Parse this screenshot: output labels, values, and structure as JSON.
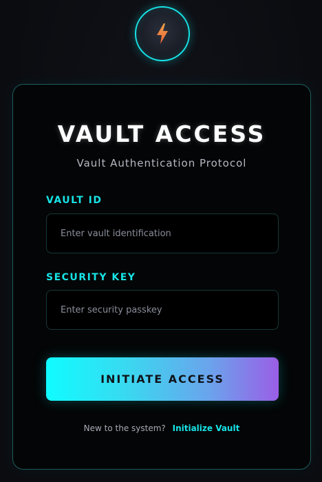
{
  "logo": {
    "icon": "lightning-bolt-icon",
    "accent": "#17e3e6",
    "bolt_color": "#f08a3c"
  },
  "card": {
    "title": "VAULT ACCESS",
    "subtitle": "Vault Authentication Protocol",
    "vault_id": {
      "label": "VAULT ID",
      "placeholder": "Enter vault identification",
      "value": ""
    },
    "security_key": {
      "label": "SECURITY KEY",
      "placeholder": "Enter security passkey",
      "value": ""
    },
    "submit_label": "INITIATE ACCESS",
    "footer": {
      "prompt": "New to the system?",
      "link_label": "Initialize Vault"
    }
  },
  "colors": {
    "accent": "#17e3e6",
    "button_gradient_start": "#0ffcff",
    "button_gradient_end": "#9a5ee6",
    "background": "#0b0c10"
  }
}
